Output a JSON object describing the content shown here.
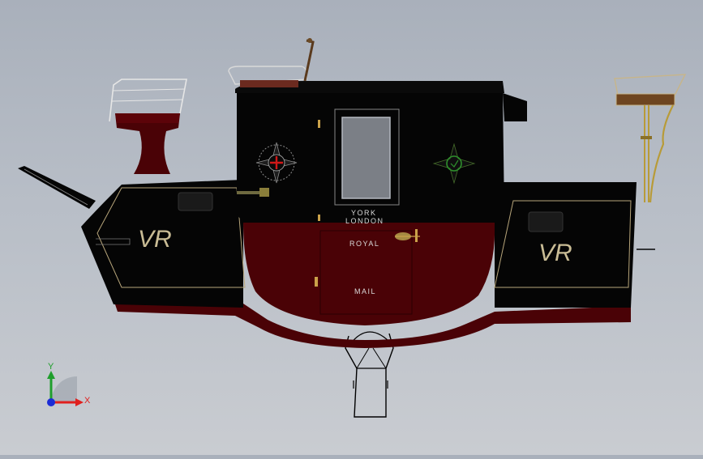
{
  "viewport": {
    "background_top": "#a9b0bb",
    "background_bottom": "#c9ccd1"
  },
  "model": {
    "body_color": "#050505",
    "accent_color": "#4a0206",
    "trim_color": "#b7a57a",
    "door_labels": {
      "line1": "YORK",
      "line2": "LONDON",
      "royal": "ROYAL",
      "mail": "MAIL"
    },
    "panel_monograms": {
      "left": "VR",
      "right": "VR"
    }
  },
  "triad": {
    "x_label": "X",
    "y_label": "Y",
    "x_color": "#e0201e",
    "y_color": "#1f9e2c",
    "z_color": "#1b2bd6"
  }
}
